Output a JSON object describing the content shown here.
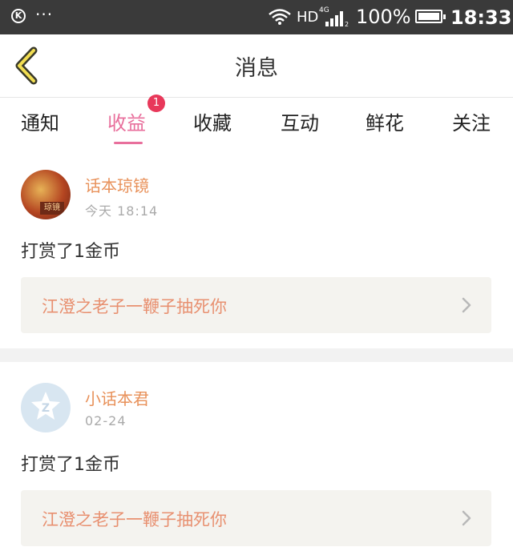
{
  "status_bar": {
    "k_icon": "K",
    "dots": "···",
    "hd": "HD",
    "network": "4G",
    "battery_percent": "100%",
    "time": "18:33"
  },
  "header": {
    "title": "消息"
  },
  "tabs": [
    {
      "label": "通知",
      "active": false
    },
    {
      "label": "收益",
      "active": true,
      "badge": "1"
    },
    {
      "label": "收藏",
      "active": false
    },
    {
      "label": "互动",
      "active": false
    },
    {
      "label": "鲜花",
      "active": false
    },
    {
      "label": "关注",
      "active": false
    }
  ],
  "feed": [
    {
      "username": "话本琼镜",
      "time": "今天 18:14",
      "action": "打赏了1金币",
      "link_text": "江澄之老子一鞭子抽死你",
      "avatar_text": "琼镜"
    },
    {
      "username": "小话本君",
      "time": "02-24",
      "action": "打赏了1金币",
      "link_text": "江澄之老子一鞭子抽死你"
    }
  ],
  "colors": {
    "accent": "#e86f9c",
    "badge": "#e8385a",
    "username": "#e8915a",
    "link_text": "#e89070",
    "status_bar": "#3a3a3a"
  }
}
